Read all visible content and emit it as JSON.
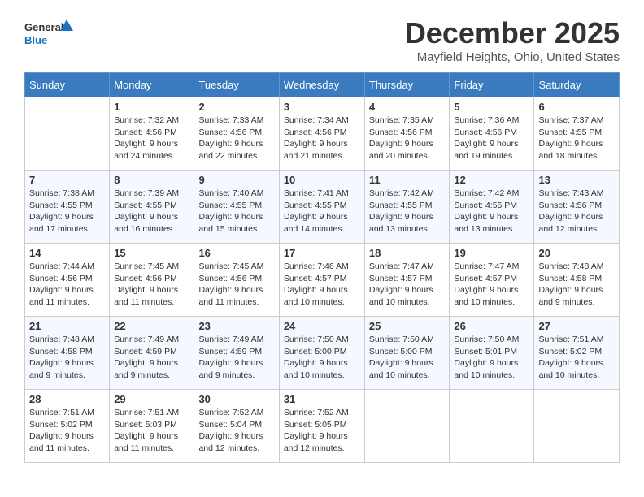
{
  "header": {
    "logo_line1": "General",
    "logo_line2": "Blue",
    "month": "December 2025",
    "location": "Mayfield Heights, Ohio, United States"
  },
  "weekdays": [
    "Sunday",
    "Monday",
    "Tuesday",
    "Wednesday",
    "Thursday",
    "Friday",
    "Saturday"
  ],
  "weeks": [
    [
      {
        "day": "",
        "info": ""
      },
      {
        "day": "1",
        "info": "Sunrise: 7:32 AM\nSunset: 4:56 PM\nDaylight: 9 hours\nand 24 minutes."
      },
      {
        "day": "2",
        "info": "Sunrise: 7:33 AM\nSunset: 4:56 PM\nDaylight: 9 hours\nand 22 minutes."
      },
      {
        "day": "3",
        "info": "Sunrise: 7:34 AM\nSunset: 4:56 PM\nDaylight: 9 hours\nand 21 minutes."
      },
      {
        "day": "4",
        "info": "Sunrise: 7:35 AM\nSunset: 4:56 PM\nDaylight: 9 hours\nand 20 minutes."
      },
      {
        "day": "5",
        "info": "Sunrise: 7:36 AM\nSunset: 4:56 PM\nDaylight: 9 hours\nand 19 minutes."
      },
      {
        "day": "6",
        "info": "Sunrise: 7:37 AM\nSunset: 4:55 PM\nDaylight: 9 hours\nand 18 minutes."
      }
    ],
    [
      {
        "day": "7",
        "info": "Sunrise: 7:38 AM\nSunset: 4:55 PM\nDaylight: 9 hours\nand 17 minutes."
      },
      {
        "day": "8",
        "info": "Sunrise: 7:39 AM\nSunset: 4:55 PM\nDaylight: 9 hours\nand 16 minutes."
      },
      {
        "day": "9",
        "info": "Sunrise: 7:40 AM\nSunset: 4:55 PM\nDaylight: 9 hours\nand 15 minutes."
      },
      {
        "day": "10",
        "info": "Sunrise: 7:41 AM\nSunset: 4:55 PM\nDaylight: 9 hours\nand 14 minutes."
      },
      {
        "day": "11",
        "info": "Sunrise: 7:42 AM\nSunset: 4:55 PM\nDaylight: 9 hours\nand 13 minutes."
      },
      {
        "day": "12",
        "info": "Sunrise: 7:42 AM\nSunset: 4:55 PM\nDaylight: 9 hours\nand 13 minutes."
      },
      {
        "day": "13",
        "info": "Sunrise: 7:43 AM\nSunset: 4:56 PM\nDaylight: 9 hours\nand 12 minutes."
      }
    ],
    [
      {
        "day": "14",
        "info": "Sunrise: 7:44 AM\nSunset: 4:56 PM\nDaylight: 9 hours\nand 11 minutes."
      },
      {
        "day": "15",
        "info": "Sunrise: 7:45 AM\nSunset: 4:56 PM\nDaylight: 9 hours\nand 11 minutes."
      },
      {
        "day": "16",
        "info": "Sunrise: 7:45 AM\nSunset: 4:56 PM\nDaylight: 9 hours\nand 11 minutes."
      },
      {
        "day": "17",
        "info": "Sunrise: 7:46 AM\nSunset: 4:57 PM\nDaylight: 9 hours\nand 10 minutes."
      },
      {
        "day": "18",
        "info": "Sunrise: 7:47 AM\nSunset: 4:57 PM\nDaylight: 9 hours\nand 10 minutes."
      },
      {
        "day": "19",
        "info": "Sunrise: 7:47 AM\nSunset: 4:57 PM\nDaylight: 9 hours\nand 10 minutes."
      },
      {
        "day": "20",
        "info": "Sunrise: 7:48 AM\nSunset: 4:58 PM\nDaylight: 9 hours\nand 9 minutes."
      }
    ],
    [
      {
        "day": "21",
        "info": "Sunrise: 7:48 AM\nSunset: 4:58 PM\nDaylight: 9 hours\nand 9 minutes."
      },
      {
        "day": "22",
        "info": "Sunrise: 7:49 AM\nSunset: 4:59 PM\nDaylight: 9 hours\nand 9 minutes."
      },
      {
        "day": "23",
        "info": "Sunrise: 7:49 AM\nSunset: 4:59 PM\nDaylight: 9 hours\nand 9 minutes."
      },
      {
        "day": "24",
        "info": "Sunrise: 7:50 AM\nSunset: 5:00 PM\nDaylight: 9 hours\nand 10 minutes."
      },
      {
        "day": "25",
        "info": "Sunrise: 7:50 AM\nSunset: 5:00 PM\nDaylight: 9 hours\nand 10 minutes."
      },
      {
        "day": "26",
        "info": "Sunrise: 7:50 AM\nSunset: 5:01 PM\nDaylight: 9 hours\nand 10 minutes."
      },
      {
        "day": "27",
        "info": "Sunrise: 7:51 AM\nSunset: 5:02 PM\nDaylight: 9 hours\nand 10 minutes."
      }
    ],
    [
      {
        "day": "28",
        "info": "Sunrise: 7:51 AM\nSunset: 5:02 PM\nDaylight: 9 hours\nand 11 minutes."
      },
      {
        "day": "29",
        "info": "Sunrise: 7:51 AM\nSunset: 5:03 PM\nDaylight: 9 hours\nand 11 minutes."
      },
      {
        "day": "30",
        "info": "Sunrise: 7:52 AM\nSunset: 5:04 PM\nDaylight: 9 hours\nand 12 minutes."
      },
      {
        "day": "31",
        "info": "Sunrise: 7:52 AM\nSunset: 5:05 PM\nDaylight: 9 hours\nand 12 minutes."
      },
      {
        "day": "",
        "info": ""
      },
      {
        "day": "",
        "info": ""
      },
      {
        "day": "",
        "info": ""
      }
    ]
  ]
}
